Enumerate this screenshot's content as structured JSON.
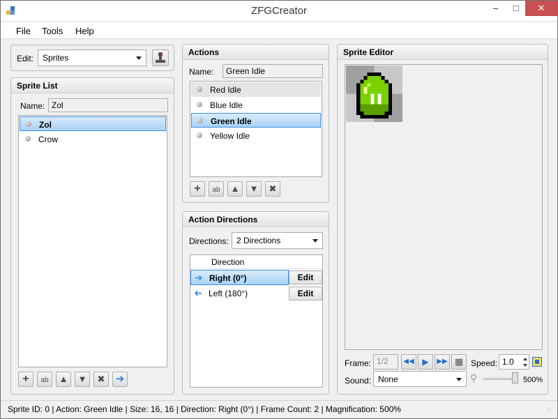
{
  "window": {
    "title": "ZFGCreator"
  },
  "menu": {
    "file": "File",
    "tools": "Tools",
    "help": "Help"
  },
  "edit": {
    "label": "Edit:",
    "selected": "Sprites"
  },
  "sprite_list": {
    "title": "Sprite List",
    "name_label": "Name:",
    "name_value": "Zol",
    "items": [
      {
        "label": "Zol"
      },
      {
        "label": "Crow"
      }
    ]
  },
  "actions": {
    "title": "Actions",
    "name_label": "Name:",
    "name_value": "Green Idle",
    "items": [
      {
        "label": "Red Idle"
      },
      {
        "label": "Blue Idle"
      },
      {
        "label": "Green Idle"
      },
      {
        "label": "Yellow Idle"
      }
    ]
  },
  "action_directions": {
    "title": "Action Directions",
    "directions_label": "Directions:",
    "directions_selected": "2 Directions",
    "column_header": "Direction",
    "rows": [
      {
        "label": "Right (0°)",
        "edit": "Edit"
      },
      {
        "label": "Left (180°)",
        "edit": "Edit"
      }
    ]
  },
  "sprite_editor": {
    "title": "Sprite Editor",
    "frame_label": "Frame:",
    "frame_value": "1/2",
    "speed_label": "Speed:",
    "speed_value": "1.0",
    "sound_label": "Sound:",
    "sound_value": "None",
    "zoom_value": "500%"
  },
  "status": "Sprite ID: 0 | Action: Green Idle | Size: 16, 16 | Direction: Right (0°) | Frame Count: 2 | Magnification: 500%",
  "colors": {
    "selection": "#a9d3f6",
    "accent": "#3b8fdb",
    "close": "#c75050"
  }
}
